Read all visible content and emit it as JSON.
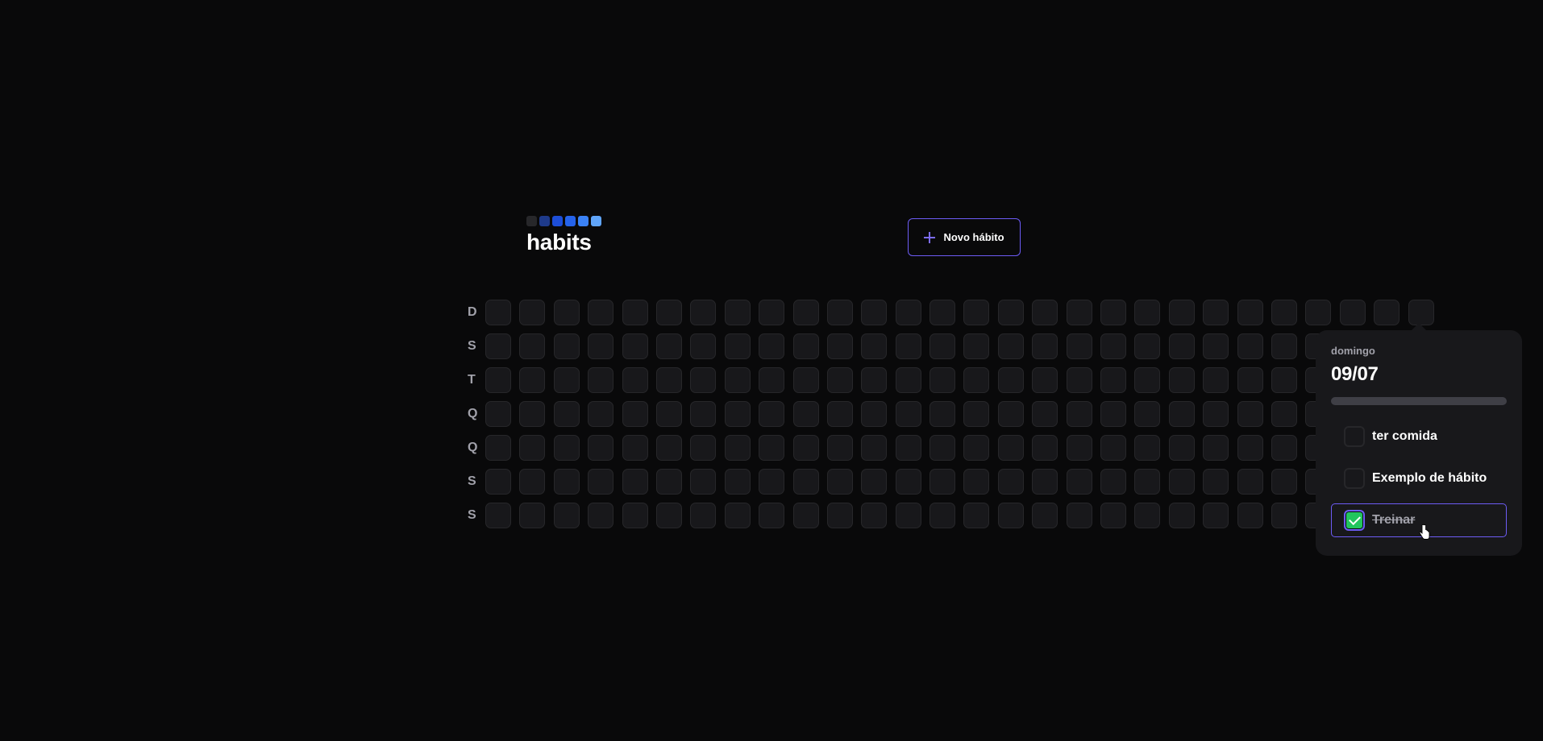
{
  "app": {
    "logo_text": "habits",
    "logo_colors": [
      "#27272a",
      "#1e3a8a",
      "#1d4ed8",
      "#2563eb",
      "#3b82f6",
      "#60a5fa"
    ]
  },
  "header": {
    "new_habit_label": "Novo hábito",
    "new_habit_icon": "plus-icon",
    "accent": "#6d5cf5"
  },
  "grid": {
    "week_days": [
      "D",
      "S",
      "T",
      "Q",
      "Q",
      "S",
      "S"
    ],
    "cell_color": "#18181b",
    "cell_border": "#27272a"
  },
  "popover": {
    "weekday": "domingo",
    "date": "09/07",
    "progress": 0,
    "habits": [
      {
        "label": "ter comida",
        "completed": false
      },
      {
        "label": "Exemplo de hábito",
        "completed": false
      },
      {
        "label": "Treinar",
        "completed": true
      }
    ],
    "check_color": "#22c55e"
  }
}
